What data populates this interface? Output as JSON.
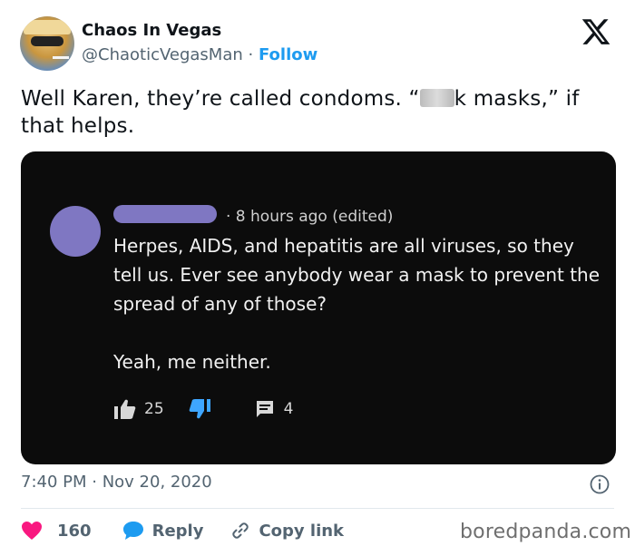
{
  "author": {
    "name": "Chaos In Vegas",
    "handle": "@ChaoticVegasMan",
    "separator": "·",
    "follow_label": "Follow"
  },
  "tweet": {
    "text_part1": "Well Karen, they’re called condoms. “",
    "text_part2": "k masks,” if that helps.",
    "timestamp": "7:40 PM · Nov 20, 2020"
  },
  "comment_screenshot": {
    "meta": "· 8 hours ago (edited)",
    "paragraph1": "Herpes, AIDS, and hepatitis are all viruses, so they tell us. Ever see anybody wear a mask to prevent the spread of any of those?",
    "paragraph2": "Yeah, me neither.",
    "likes": "25",
    "replies": "4"
  },
  "actions": {
    "like_count": "160",
    "reply_label": "Reply",
    "copy_link_label": "Copy link"
  },
  "watermark": "boredpanda.com",
  "colors": {
    "accent": "#1d9bf0",
    "heart": "#f91880",
    "dark_background": "#0c0c0c",
    "redacted_purple": "#7f77c2",
    "dislike_blue": "#3ea6ff"
  },
  "icons": {
    "logo": "x-logo-icon",
    "info": "info-icon",
    "like": "heart-icon",
    "reply": "speech-bubble-icon",
    "copy": "link-icon"
  }
}
